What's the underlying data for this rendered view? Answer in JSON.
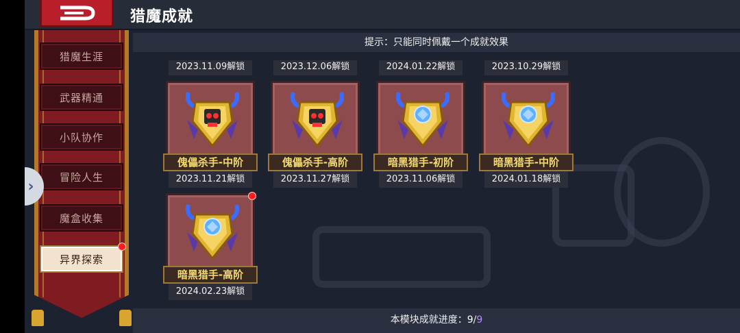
{
  "header": {
    "title": "猎魔成就"
  },
  "hint": "提示：只能同时佩戴一个成就效果",
  "sidebar": {
    "items": [
      {
        "label": "猎魔生涯"
      },
      {
        "label": "武器精通"
      },
      {
        "label": "小队协作"
      },
      {
        "label": "冒险人生"
      },
      {
        "label": "魔盒收集"
      },
      {
        "label": "异界探索"
      }
    ]
  },
  "top_dates": [
    "2023.11.09解锁",
    "2023.12.06解锁",
    "2024.01.22解锁",
    "2023.10.29解锁"
  ],
  "achievements": [
    {
      "name": "傀儡杀手-中阶",
      "date": "2023.11.21解锁",
      "gem": "robot",
      "color": "#ff3030"
    },
    {
      "name": "傀儡杀手-高阶",
      "date": "2023.11.27解锁",
      "gem": "robot",
      "color": "#ff3030"
    },
    {
      "name": "暗黑猎手-初阶",
      "date": "2023.11.06解锁",
      "gem": "crystal",
      "color": "#5fb0ff"
    },
    {
      "name": "暗黑猎手-中阶",
      "date": "2024.01.18解锁",
      "gem": "crystal",
      "color": "#5fb0ff"
    },
    {
      "name": "暗黑猎手-高阶",
      "date": "2024.02.23解锁",
      "gem": "crystal",
      "color": "#5fb0ff"
    }
  ],
  "progress": {
    "label": "本模块成就进度：",
    "current": "9",
    "sep": "/",
    "total": "9"
  },
  "colors": {
    "accent_red": "#b81f2a",
    "gold": "#f4d96c",
    "banner": "#7e1c22"
  }
}
